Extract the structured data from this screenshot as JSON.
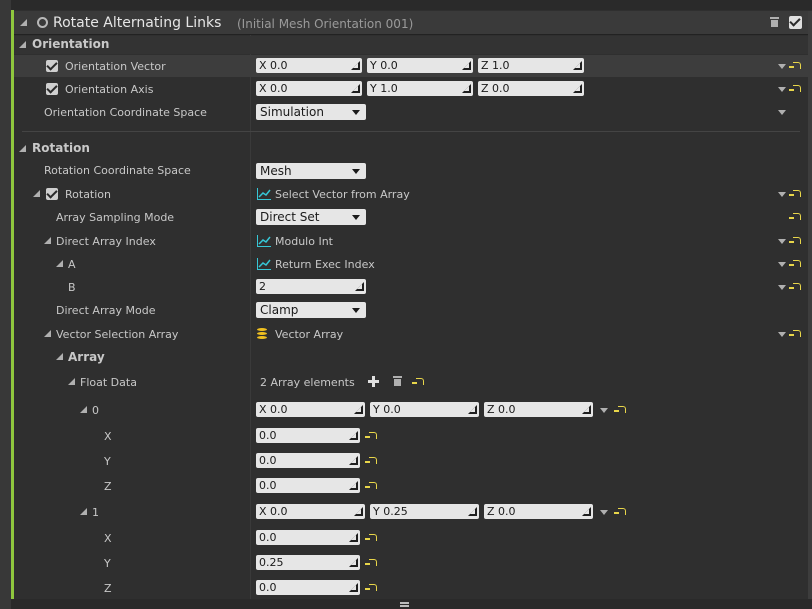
{
  "module": {
    "title": "Rotate Alternating Links",
    "subtitle": "(Initial Mesh Orientation 001)"
  },
  "orientation": {
    "section_label": "Orientation",
    "vector": {
      "label": "Orientation Vector",
      "x": "X 0.0",
      "y": "Y 0.0",
      "z": "Z 1.0"
    },
    "axis": {
      "label": "Orientation Axis",
      "x": "X 0.0",
      "y": "Y 1.0",
      "z": "Z 0.0"
    },
    "coord_space": {
      "label": "Orientation Coordinate Space",
      "value": "Simulation"
    }
  },
  "rotation": {
    "section_label": "Rotation",
    "coord_space": {
      "label": "Rotation Coordinate Space",
      "value": "Mesh"
    },
    "rotation": {
      "label": "Rotation",
      "value": "Select Vector from Array"
    },
    "sampling_mode": {
      "label": "Array Sampling Mode",
      "value": "Direct Set"
    },
    "direct_index": {
      "label": "Direct Array Index",
      "value": "Modulo Int"
    },
    "a": {
      "label": "A",
      "value": "Return Exec Index"
    },
    "b": {
      "label": "B",
      "value": "2"
    },
    "direct_mode": {
      "label": "Direct Array Mode",
      "value": "Clamp"
    },
    "vector_array": {
      "label": "Vector Selection Array",
      "value": "Vector Array"
    },
    "array_label": "Array",
    "float_data": {
      "label": "Float Data",
      "value": "2 Array elements"
    },
    "elements": [
      {
        "label": "0",
        "x": "X  0.0",
        "y": "Y  0.0",
        "z": "Z  0.0",
        "xl": "X",
        "yl": "Y",
        "zl": "Z",
        "xv": "0.0",
        "yv": "0.0",
        "zv": "0.0"
      },
      {
        "label": "1",
        "x": "X  0.0",
        "y": "Y  0.25",
        "z": "Z  0.0",
        "xl": "X",
        "yl": "Y",
        "zl": "Z",
        "xv": "0.0",
        "yv": "0.25",
        "zv": "0.0"
      }
    ]
  },
  "colors": {
    "accent": "#8fc73e",
    "reset": "#e8d64a",
    "graph": "#36c7d6",
    "db": "#f0c020"
  }
}
